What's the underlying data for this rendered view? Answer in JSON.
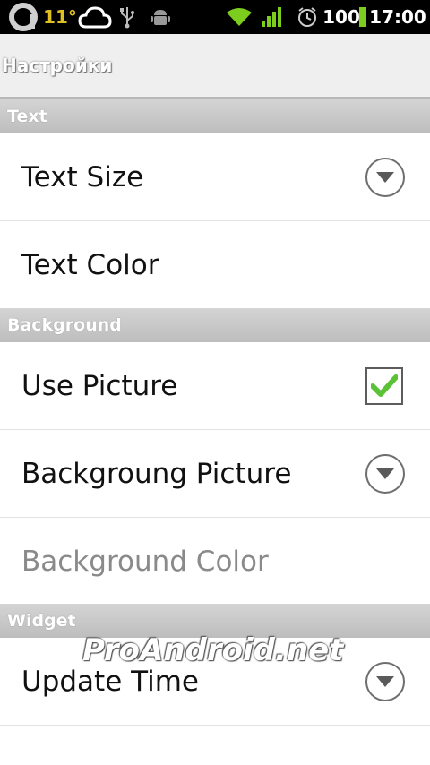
{
  "status_bar": {
    "temperature": "11°",
    "battery": "100",
    "time": "17:00",
    "icons": [
      "app-logo-icon",
      "cloud-icon",
      "usb-icon",
      "android-debug-icon",
      "wifi-icon",
      "signal-icon",
      "alarm-icon",
      "battery-icon"
    ]
  },
  "title_bar": {
    "title": "Настройки"
  },
  "sections": {
    "text": {
      "header": "Text",
      "text_size": "Text Size",
      "text_color": "Text Color"
    },
    "background": {
      "header": "Background",
      "use_picture": "Use Picture",
      "use_picture_checked": true,
      "background_picture": "Backgroung Picture",
      "background_color": "Background Color"
    },
    "widget": {
      "header": "Widget",
      "update_time": "Update Time"
    }
  },
  "watermark": "ProAndroid.net",
  "colors": {
    "status_bar_bg": "#000000",
    "title_bar_bg": "#efefef",
    "category_bg": "#c6c6c6",
    "checkmark": "#5bc236",
    "wifi": "#7ccd1e",
    "battery": "#7ccd1e"
  }
}
